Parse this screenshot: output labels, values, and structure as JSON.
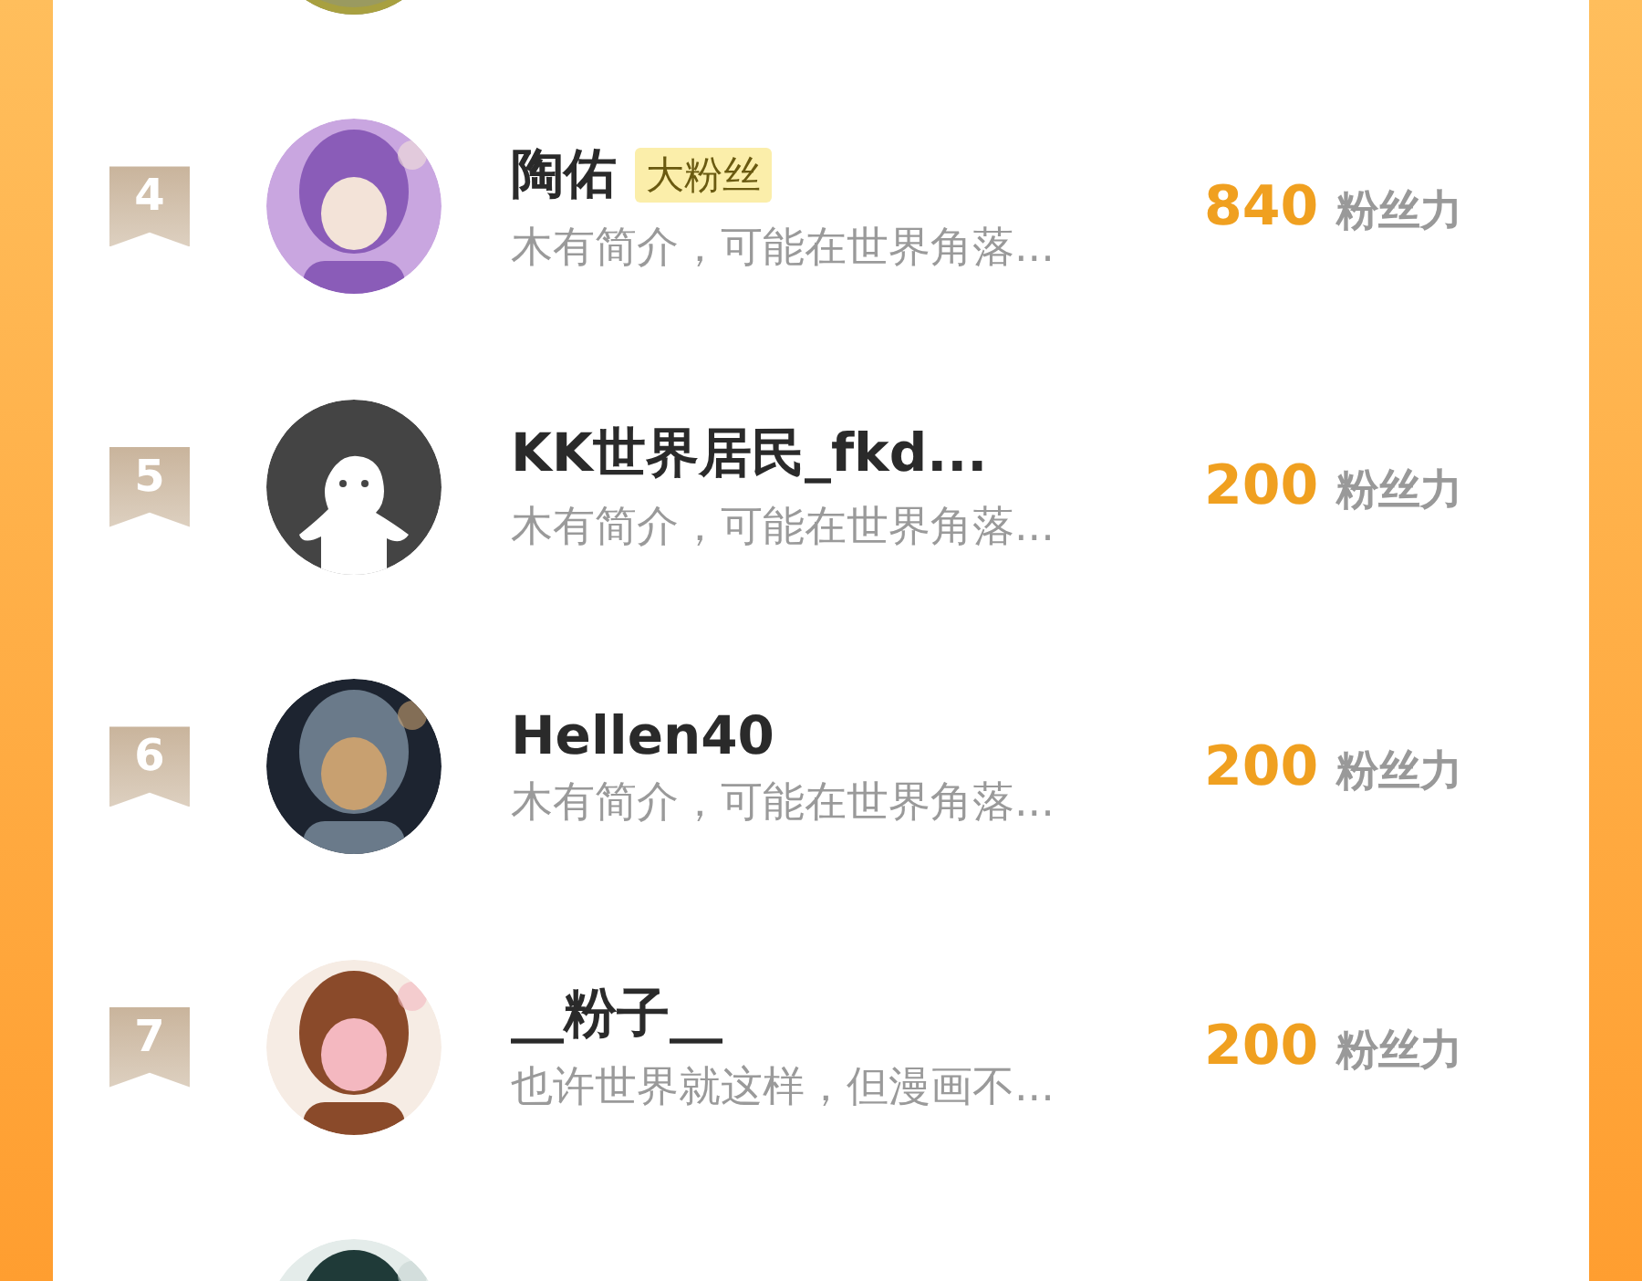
{
  "rows": [
    {
      "kind": "cut"
    },
    {
      "kind": "full",
      "rank": "4",
      "name": "陶佑",
      "tag": "大粉丝",
      "bio": "木有简介，可能在世界角落...",
      "score": "840",
      "score_unit": "粉丝力"
    },
    {
      "kind": "full",
      "rank": "5",
      "avatar": {
        "kind": "default"
      },
      "name": "KK世界居民_fkd...",
      "bio": "木有简介，可能在世界角落...",
      "score": "200",
      "score_unit": "粉丝力"
    },
    {
      "kind": "full",
      "rank": "6",
      "name": "Hellen40",
      "bio": "木有简介，可能在世界角落...",
      "score": "200",
      "score_unit": "粉丝力"
    },
    {
      "kind": "full",
      "rank": "7",
      "name": "__粉子__",
      "bio": "也许世界就这样，但漫画不...",
      "score": "200",
      "score_unit": "粉丝力"
    },
    {
      "kind": "cut"
    }
  ]
}
